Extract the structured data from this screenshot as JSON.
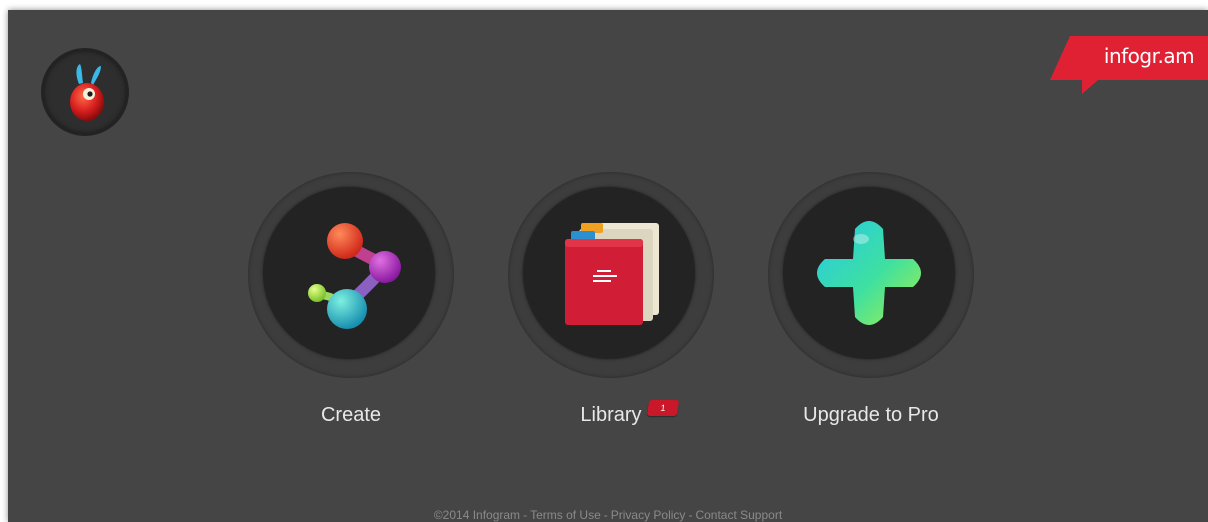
{
  "brand": {
    "logo_text": "infogr.am"
  },
  "user": {
    "avatar_icon": "bunny-mascot-icon"
  },
  "tiles": [
    {
      "label": "Create",
      "icon": "molecule-icon"
    },
    {
      "label": "Library",
      "icon": "folders-icon",
      "badge": "1"
    },
    {
      "label": "Upgrade to Pro",
      "icon": "plus-icon"
    }
  ],
  "footer": {
    "copyright": "©2014 Infogram",
    "links": [
      "Terms of Use",
      "Privacy Policy",
      "Contact Support"
    ]
  },
  "colors": {
    "background": "#454545",
    "brand_red": "#e02134",
    "badge_red": "#c8182a"
  }
}
